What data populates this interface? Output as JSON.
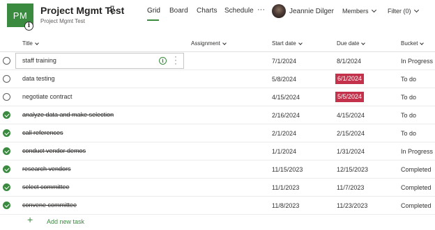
{
  "plan": {
    "avatar_initials": "PM",
    "info_badge": "i",
    "title": "Project Mgmt Test",
    "subtitle": "Project Mgmt Test"
  },
  "nav": {
    "tabs": [
      "Grid",
      "Board",
      "Charts",
      "Schedule"
    ],
    "active_tab": "Grid",
    "more": "···",
    "user_name": "Jeannie Dilger",
    "members_label": "Members",
    "filter_label": "Filter (0)"
  },
  "columns": {
    "title": "Title",
    "assignment": "Assignment",
    "start_date": "Start date",
    "due_date": "Due date",
    "bucket": "Bucket"
  },
  "tasks": [
    {
      "name": "staff training",
      "done": false,
      "start": "7/1/2024",
      "due": "8/1/2024",
      "overdue": false,
      "bucket": "In Progress",
      "selected": true
    },
    {
      "name": "data testing",
      "done": false,
      "start": "5/8/2024",
      "due": "6/1/2024",
      "overdue": true,
      "bucket": "To do",
      "selected": false
    },
    {
      "name": "negotiate contract",
      "done": false,
      "start": "4/15/2024",
      "due": "5/5/2024",
      "overdue": true,
      "bucket": "To do",
      "selected": false
    },
    {
      "name": "analyze data and make selection",
      "done": true,
      "start": "2/16/2024",
      "due": "4/15/2024",
      "overdue": false,
      "bucket": "To do",
      "selected": false
    },
    {
      "name": "call references",
      "done": true,
      "start": "2/1/2024",
      "due": "2/15/2024",
      "overdue": false,
      "bucket": "To do",
      "selected": false
    },
    {
      "name": "conduct vendor demos",
      "done": true,
      "start": "1/1/2024",
      "due": "1/31/2024",
      "overdue": false,
      "bucket": "In Progress",
      "selected": false
    },
    {
      "name": "research vendors",
      "done": true,
      "start": "11/15/2023",
      "due": "12/15/2023",
      "overdue": false,
      "bucket": "Completed",
      "selected": false
    },
    {
      "name": "select committee",
      "done": true,
      "start": "11/1/2023",
      "due": "11/7/2023",
      "overdue": false,
      "bucket": "Completed",
      "selected": false
    },
    {
      "name": "convene committee",
      "done": true,
      "start": "11/8/2023",
      "due": "11/23/2023",
      "overdue": false,
      "bucket": "Completed",
      "selected": false
    }
  ],
  "footer": {
    "add_icon": "+",
    "add_label": "Add new task"
  },
  "colors": {
    "accent": "#3a8a3f",
    "overdue": "#c4314b"
  }
}
